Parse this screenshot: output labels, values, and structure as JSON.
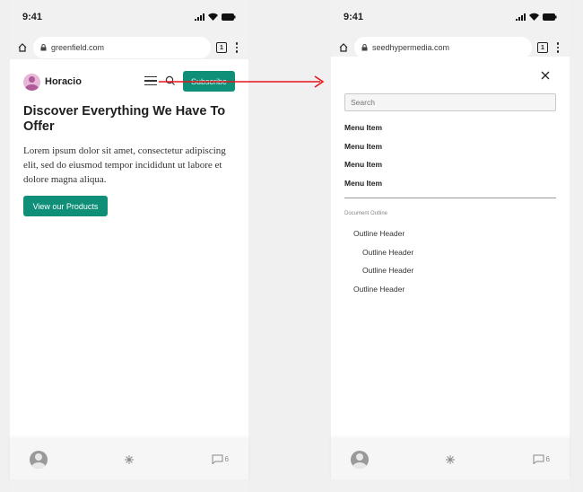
{
  "left": {
    "status_time": "9:41",
    "url": "greenfield.com",
    "tab_count": "1",
    "site_name": "Horacio",
    "subscribe_label": "Subscribe",
    "hero_title": "Discover Everything We Have To Offer",
    "hero_body": "Lorem ipsum dolor sit amet, consectetur adipiscing elit, sed do eiusmod tempor incididunt ut labore et dolore magna aliqua.",
    "cta_label": "View our Products",
    "comments_count": "6"
  },
  "right": {
    "status_time": "9:41",
    "url": "seedhypermedia.com",
    "tab_count": "1",
    "search_placeholder": "Search",
    "menu_items": [
      "Menu Item",
      "Menu Item",
      "Menu Item",
      "Menu Item"
    ],
    "outline_label": "Document Outline",
    "outline": [
      {
        "label": "Outline Header",
        "level": 1
      },
      {
        "label": "Outline Header",
        "level": 2
      },
      {
        "label": "Outline Header",
        "level": 2
      },
      {
        "label": "Outline Header",
        "level": 1
      }
    ],
    "comments_count": "6"
  },
  "colors": {
    "accent": "#0f8f78",
    "arrow": "#e8141c",
    "background": "#f0f0f1"
  },
  "icons": [
    "home-icon",
    "lock-icon",
    "tabs-icon",
    "more-icon",
    "menu-icon",
    "search-icon",
    "close-icon",
    "user-icon",
    "sparkle-icon",
    "comment-icon",
    "signal-icon",
    "wifi-icon",
    "battery-icon"
  ]
}
